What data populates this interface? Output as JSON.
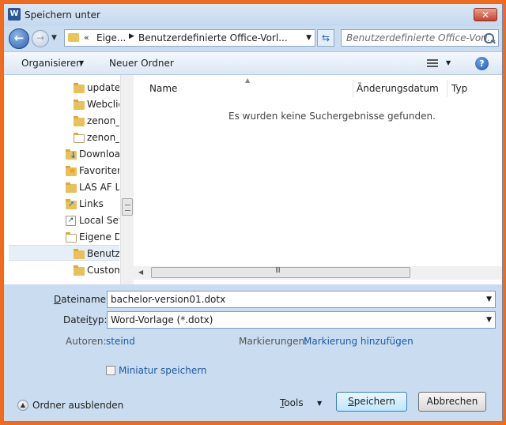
{
  "window": {
    "title": "Speichern unter",
    "app_icon": "W"
  },
  "nav": {
    "breadcrumb_prefix": "«",
    "breadcrumb": [
      "Eige...",
      "Benutzerdefinierte Office-Vorl..."
    ],
    "search_placeholder": "Benutzerdefinierte Office-Vorl..."
  },
  "toolbar": {
    "organize": "Organisieren",
    "new_folder": "Neuer Ordner"
  },
  "tree": {
    "items": [
      {
        "label": "update",
        "icon": "folder-icon"
      },
      {
        "label": "Webclie",
        "icon": "folder-icon"
      },
      {
        "label": "zenon_",
        "icon": "folder-icon"
      },
      {
        "label": "zenon_",
        "icon": "folder-icon"
      },
      {
        "label": "Download",
        "icon": "download-folder-icon"
      },
      {
        "label": "Favoriten",
        "icon": "favorites-icon"
      },
      {
        "label": "LAS AF Li",
        "icon": "folder-icon"
      },
      {
        "label": "Links",
        "icon": "links-folder-icon"
      },
      {
        "label": "Local Sett",
        "icon": "shortcut-icon"
      },
      {
        "label": "Eigene Do",
        "icon": "documents-folder-icon"
      },
      {
        "label": "Benutze",
        "icon": "folder-icon"
      },
      {
        "label": "Custom",
        "icon": "folder-icon"
      }
    ]
  },
  "files": {
    "columns": [
      "Name",
      "Änderungsdatum",
      "Typ"
    ],
    "empty_message": "Es wurden keine Suchergebnisse gefunden."
  },
  "form": {
    "filename_label_u": "D",
    "filename_label_rest": "ateiname:",
    "filename_value": "bachelor-version01.dotx",
    "filetype_label_pre": "Datei",
    "filetype_label_u": "t",
    "filetype_label_rest": "yp:",
    "filetype_value": "Word-Vorlage (*.dotx)",
    "authors_label": "Autoren:",
    "authors_value": "steind",
    "tags_label": "Markierungen:",
    "tags_value": "Markierung hinzufügen",
    "thumbnail_label": "Miniatur speichern"
  },
  "footer": {
    "hide_folders": "Ordner ausblenden",
    "tools_u": "T",
    "tools_rest": "ools",
    "save_u": "S",
    "save_rest": "peichern",
    "cancel": "Abbrechen"
  }
}
